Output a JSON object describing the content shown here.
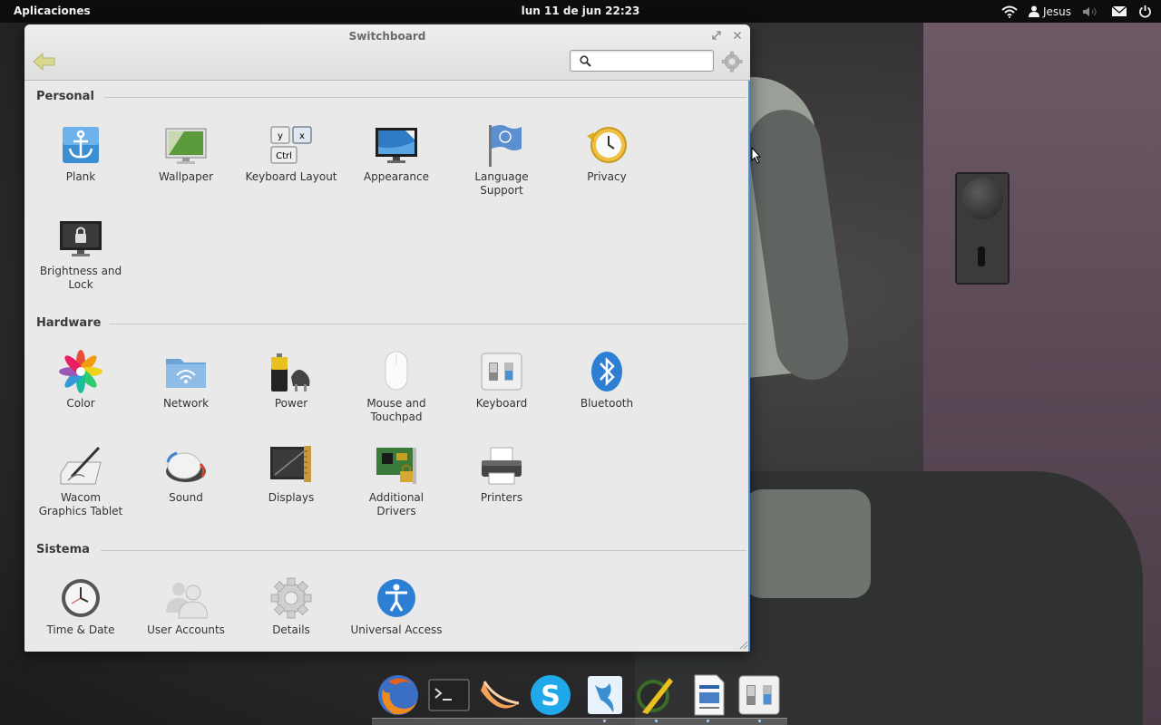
{
  "top_panel": {
    "apps_label": "Aplicaciones",
    "clock": "lun 11 de jun 22:23",
    "user_name": "Jesus",
    "icons": [
      "wifi-icon",
      "user-icon",
      "volume-muted-icon",
      "mail-icon",
      "power-icon"
    ]
  },
  "window": {
    "title": "Switchboard",
    "search": {
      "value": "",
      "placeholder": ""
    },
    "accent": "#4a90d9"
  },
  "sections": [
    {
      "title": "Personal",
      "items": [
        {
          "label": "Plank",
          "icon": "plank-anchor-icon"
        },
        {
          "label": "Wallpaper",
          "icon": "wallpaper-icon"
        },
        {
          "label": "Keyboard Layout",
          "icon": "keyboard-layout-icon"
        },
        {
          "label": "Appearance",
          "icon": "appearance-icon"
        },
        {
          "label": "Language\nSupport",
          "icon": "language-flag-icon"
        },
        {
          "label": "Privacy",
          "icon": "privacy-clock-icon"
        },
        {
          "label": "Brightness and\nLock",
          "icon": "brightness-lock-icon"
        }
      ]
    },
    {
      "title": "Hardware",
      "items": [
        {
          "label": "Color",
          "icon": "color-icon"
        },
        {
          "label": "Network",
          "icon": "network-folder-icon"
        },
        {
          "label": "Power",
          "icon": "power-battery-icon"
        },
        {
          "label": "Mouse and\nTouchpad",
          "icon": "mouse-icon"
        },
        {
          "label": "Keyboard",
          "icon": "keyboard-icon"
        },
        {
          "label": "Bluetooth",
          "icon": "bluetooth-icon"
        },
        {
          "label": "Wacom\nGraphics Tablet",
          "icon": "wacom-tablet-icon"
        },
        {
          "label": "Sound",
          "icon": "sound-icon"
        },
        {
          "label": "Displays",
          "icon": "displays-icon"
        },
        {
          "label": "Additional\nDrivers",
          "icon": "drivers-chip-icon"
        },
        {
          "label": "Printers",
          "icon": "printer-icon"
        }
      ]
    },
    {
      "title": "Sistema",
      "items": [
        {
          "label": "Time & Date",
          "icon": "clock-icon"
        },
        {
          "label": "User Accounts",
          "icon": "user-accounts-icon"
        },
        {
          "label": "Details",
          "icon": "details-gear-icon"
        },
        {
          "label": "Universal Access",
          "icon": "universal-access-icon"
        }
      ]
    }
  ],
  "dock": {
    "items": [
      {
        "name": "firefox",
        "icon": "firefox-icon"
      },
      {
        "name": "terminal",
        "icon": "terminal-icon"
      },
      {
        "name": "midori",
        "icon": "citrus-icon"
      },
      {
        "name": "skype",
        "icon": "skype-icon"
      },
      {
        "name": "shotwell",
        "icon": "bird-icon"
      },
      {
        "name": "inkscape",
        "icon": "globe-pen-icon"
      },
      {
        "name": "writer",
        "icon": "document-icon"
      },
      {
        "name": "switchboard",
        "icon": "switchboard-icon"
      }
    ]
  }
}
